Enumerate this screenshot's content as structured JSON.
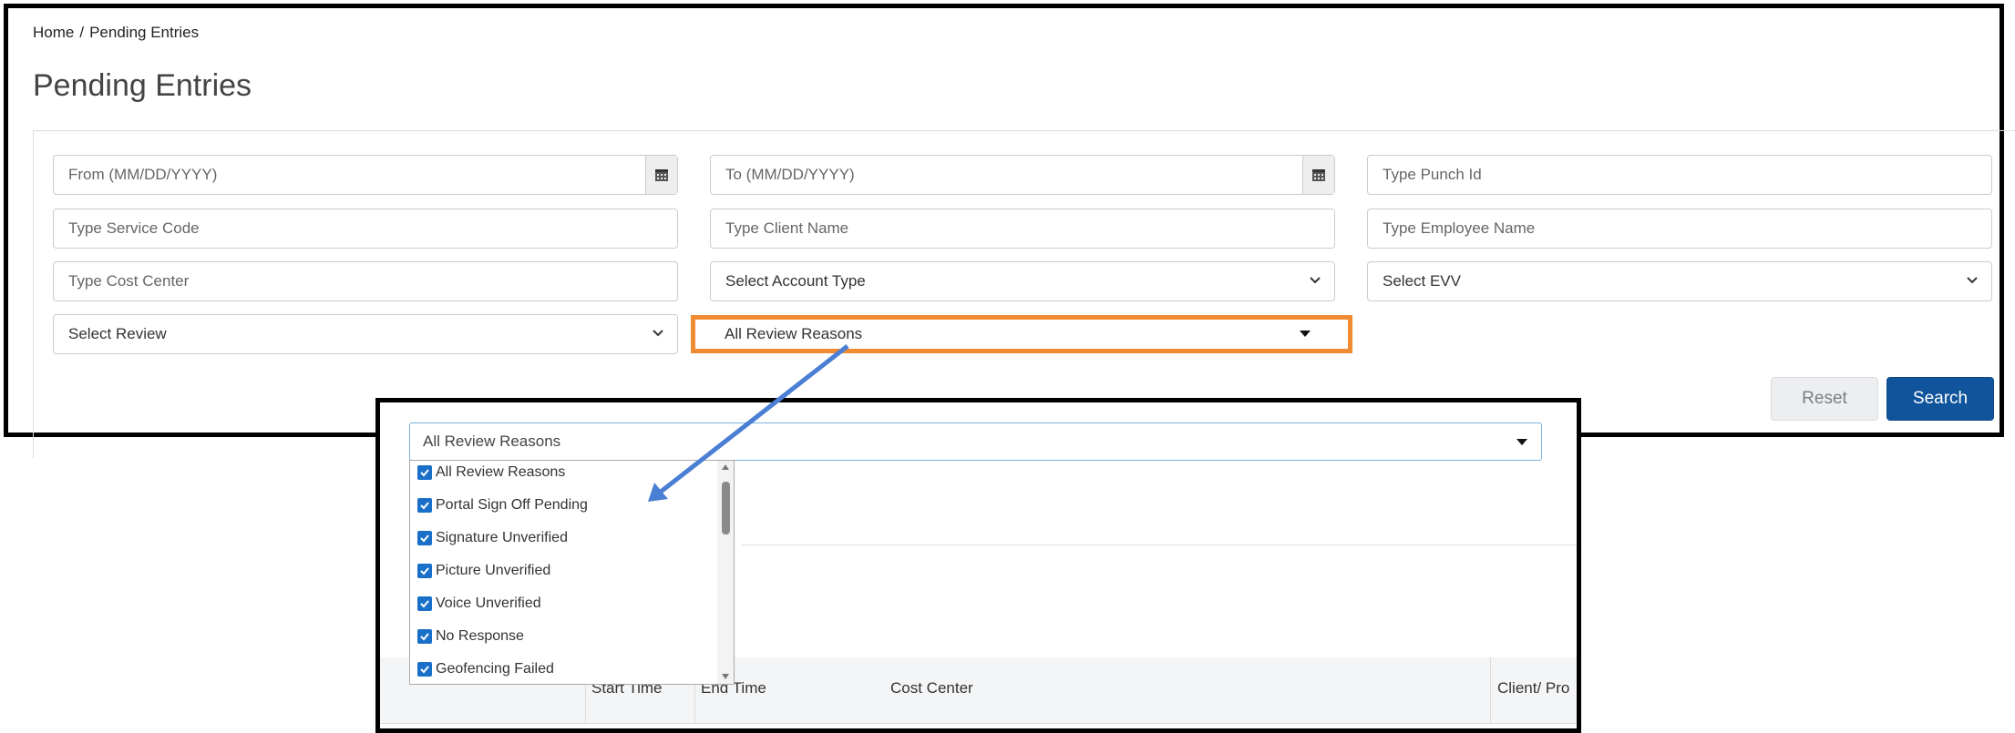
{
  "breadcrumb": {
    "home": "Home",
    "current": "Pending Entries"
  },
  "page_title": "Pending Entries",
  "filters": {
    "from_date": "From (MM/DD/YYYY)",
    "to_date": "To (MM/DD/YYYY)",
    "punch_id": "Type Punch Id",
    "service_code": "Type Service Code",
    "client_name": "Type Client Name",
    "employee_name": "Type Employee Name",
    "cost_center": "Type Cost Center",
    "account_type": "Select Account Type",
    "evv": "Select EVV",
    "review": "Select Review",
    "review_reasons": "All Review Reasons"
  },
  "buttons": {
    "reset": "Reset",
    "search": "Search"
  },
  "zoom": {
    "select_value": "All Review Reasons",
    "options": [
      "All Review Reasons",
      "Portal Sign Off Pending",
      "Signature Unverified",
      "Picture Unverified",
      "Voice Unverified",
      "No Response",
      "Geofencing Failed"
    ],
    "table_headers": [
      "Start Time",
      "End Time",
      "Cost Center",
      "Client/ Pro"
    ]
  },
  "colors": {
    "highlight": "#f08a33",
    "arrow": "#4a7fd4",
    "primary": "#10549c",
    "checkbox": "#1a6fc8"
  }
}
